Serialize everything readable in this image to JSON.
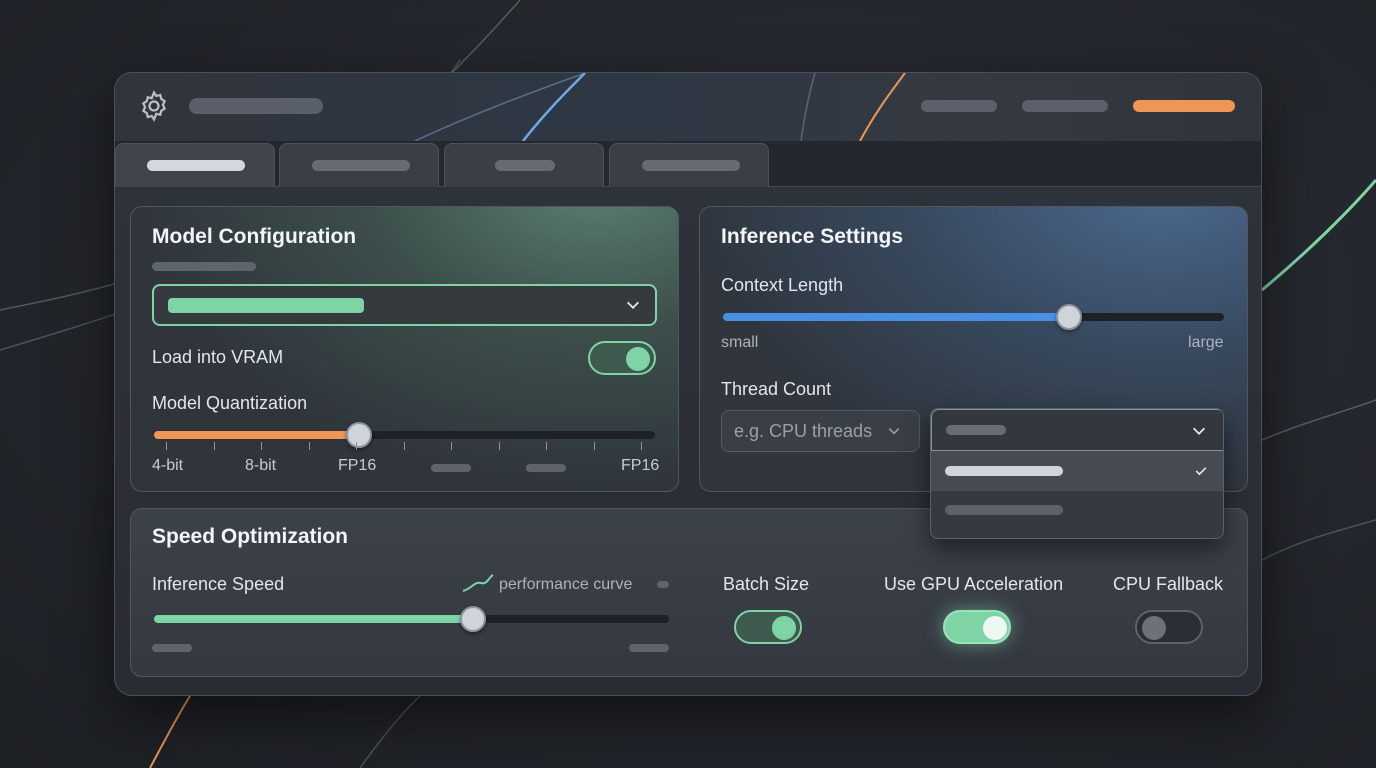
{
  "colors": {
    "accent_green": "#7fd4a5",
    "accent_blue": "#4a90e2",
    "accent_orange": "#ef9555",
    "window_bg": "#2d3037"
  },
  "titlebar": {
    "icon": "gear-icon"
  },
  "model_config": {
    "title": "Model Configuration",
    "vram_label": "Load into VRAM",
    "vram_enabled": true,
    "quant_label": "Model Quantization",
    "quant_value_fraction": 0.41,
    "quant_ticks": [
      "4-bit",
      "8-bit",
      "FP16",
      "FP16"
    ]
  },
  "inference": {
    "title": "Inference Settings",
    "context_label": "Context Length",
    "context_value_fraction": 0.69,
    "context_min": "small",
    "context_max": "large",
    "thread_label": "Thread Count",
    "thread_placeholder": "e.g. CPU threads"
  },
  "speed": {
    "title": "Speed Optimization",
    "speed_label": "Inference Speed",
    "curve_label": "performance curve",
    "speed_value_fraction": 0.62,
    "batch_label": "Batch Size",
    "batch_enabled": true,
    "gpu_label": "Use GPU Acceleration",
    "gpu_enabled": true,
    "cpu_label": "CPU Fallback",
    "cpu_enabled": false
  }
}
